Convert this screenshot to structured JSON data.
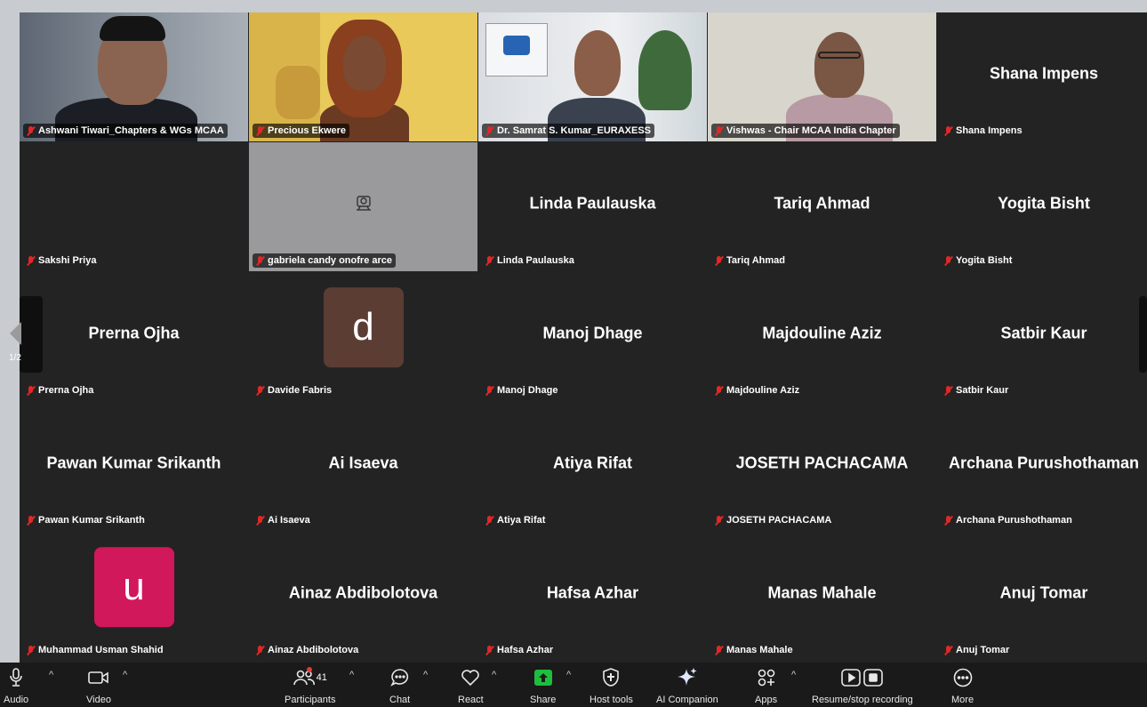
{
  "grid": {
    "page_indicator": "1/2",
    "tiles": [
      {
        "name": "Ashwani Tiwari_Chapters & WGs MCAA",
        "display_name": "",
        "type": "video"
      },
      {
        "name": "Precious Ekwere",
        "display_name": "",
        "type": "video"
      },
      {
        "name": "Dr. Samrat S. Kumar_EURAXESS",
        "display_name": "",
        "type": "video"
      },
      {
        "name": "Vishwas - Chair MCAA India Chapter",
        "display_name": "",
        "type": "video",
        "active_speaker": true
      },
      {
        "name": "Shana Impens",
        "display_name": "Shana Impens",
        "type": "name"
      },
      {
        "name": "Sakshi Priya",
        "display_name": "",
        "type": "blank"
      },
      {
        "name": "gabriela candy onofre arce",
        "display_name": "",
        "type": "camera-off"
      },
      {
        "name": "Linda Paulauska",
        "display_name": "Linda Paulauska",
        "type": "name"
      },
      {
        "name": "Tariq Ahmad",
        "display_name": "Tariq Ahmad",
        "type": "name"
      },
      {
        "name": "Yogita Bisht",
        "display_name": "Yogita Bisht",
        "type": "name"
      },
      {
        "name": "Prerna Ojha",
        "display_name": "Prerna Ojha",
        "type": "name"
      },
      {
        "name": "Davide Fabris",
        "display_name": "",
        "type": "avatar",
        "avatar_letter": "d",
        "avatar_color": "#5b3d34"
      },
      {
        "name": "Manoj Dhage",
        "display_name": "Manoj Dhage",
        "type": "name"
      },
      {
        "name": "Majdouline Aziz",
        "display_name": "Majdouline Aziz",
        "type": "name"
      },
      {
        "name": "Satbir Kaur",
        "display_name": "Satbir Kaur",
        "type": "name"
      },
      {
        "name": "Pawan Kumar Srikanth",
        "display_name": "Pawan Kumar Srikanth",
        "type": "name"
      },
      {
        "name": "Ai Isaeva",
        "display_name": "Ai Isaeva",
        "type": "name"
      },
      {
        "name": "Atiya Rifat",
        "display_name": "Atiya Rifat",
        "type": "name"
      },
      {
        "name": "JOSETH PACHACAMA",
        "display_name": "JOSETH PACHACAMA",
        "type": "name"
      },
      {
        "name": "Archana Purushothaman",
        "display_name": "Archana Purushothaman",
        "type": "name"
      },
      {
        "name": "Muhammad Usman Shahid",
        "display_name": "",
        "type": "avatar",
        "avatar_letter": "u",
        "avatar_color": "#d0185a"
      },
      {
        "name": "Ainaz Abdibolotova",
        "display_name": "Ainaz Abdibolotova",
        "type": "name"
      },
      {
        "name": "Hafsa Azhar",
        "display_name": "Hafsa Azhar",
        "type": "name"
      },
      {
        "name": "Manas Mahale",
        "display_name": "Manas Mahale",
        "type": "name"
      },
      {
        "name": "Anuj Tomar",
        "display_name": "Anuj Tomar",
        "type": "name"
      }
    ]
  },
  "toolbar": {
    "audio": "Audio",
    "video": "Video",
    "participants": "Participants",
    "participant_count": "41",
    "chat": "Chat",
    "react": "React",
    "share": "Share",
    "host_tools": "Host tools",
    "ai_companion": "AI Companion",
    "apps": "Apps",
    "recording": "Resume/stop recording",
    "more": "More"
  },
  "colors": {
    "active_speaker": "#23d959",
    "share_green": "#1fbd3f",
    "muted_red": "#e02828"
  }
}
